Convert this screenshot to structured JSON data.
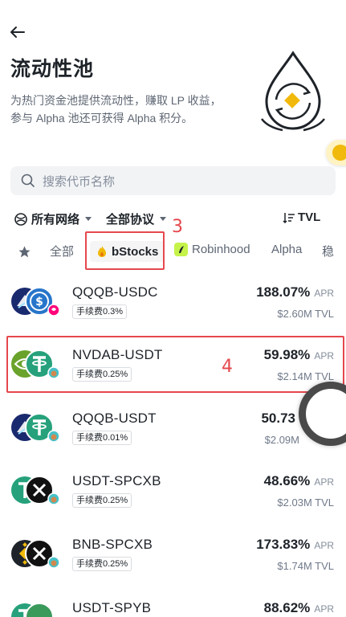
{
  "header": {
    "title": "流动性池",
    "description_line1": "为热门资金池提供流动性，赚取 LP 收益，",
    "description_line2": "参与 Alpha 池还可获得 Alpha 积分。"
  },
  "search": {
    "placeholder": "搜索代币名称"
  },
  "filters": {
    "network": "所有网络",
    "protocol": "全部协议",
    "sort": "TVL"
  },
  "tabs": [
    {
      "label": "全部"
    },
    {
      "label": "bStocks"
    },
    {
      "label": "Robinhood"
    },
    {
      "label": "Alpha"
    },
    {
      "label": "稳"
    }
  ],
  "annotations": {
    "tab_marker": "3",
    "row_marker": "4"
  },
  "pools": [
    {
      "pair": "QQQB-USDC",
      "fee": "手续费0.3%",
      "apr": "188.07%",
      "apr_label": "APR",
      "tvl": "$2.60M TVL"
    },
    {
      "pair": "NVDAB-USDT",
      "fee": "手续费0.25%",
      "apr": "59.98%",
      "apr_label": "APR",
      "tvl": "$2.14M TVL"
    },
    {
      "pair": "QQQB-USDT",
      "fee": "手续费0.01%",
      "apr": "50.73",
      "apr_label": "",
      "tvl": "$2.09M"
    },
    {
      "pair": "USDT-SPCXB",
      "fee": "手续费0.25%",
      "apr": "48.66%",
      "apr_label": "APR",
      "tvl": "$2.03M TVL"
    },
    {
      "pair": "BNB-SPCXB",
      "fee": "手续费0.25%",
      "apr": "173.83%",
      "apr_label": "APR",
      "tvl": "$1.74M TVL"
    },
    {
      "pair": "USDT-SPYB",
      "fee": "",
      "apr": "88.62%",
      "apr_label": "APR",
      "tvl": ""
    }
  ],
  "colors": {
    "accent": "#f0b90b",
    "annotation": "#e5484d",
    "tether": "#26a17b",
    "usdc": "#2775ca"
  }
}
